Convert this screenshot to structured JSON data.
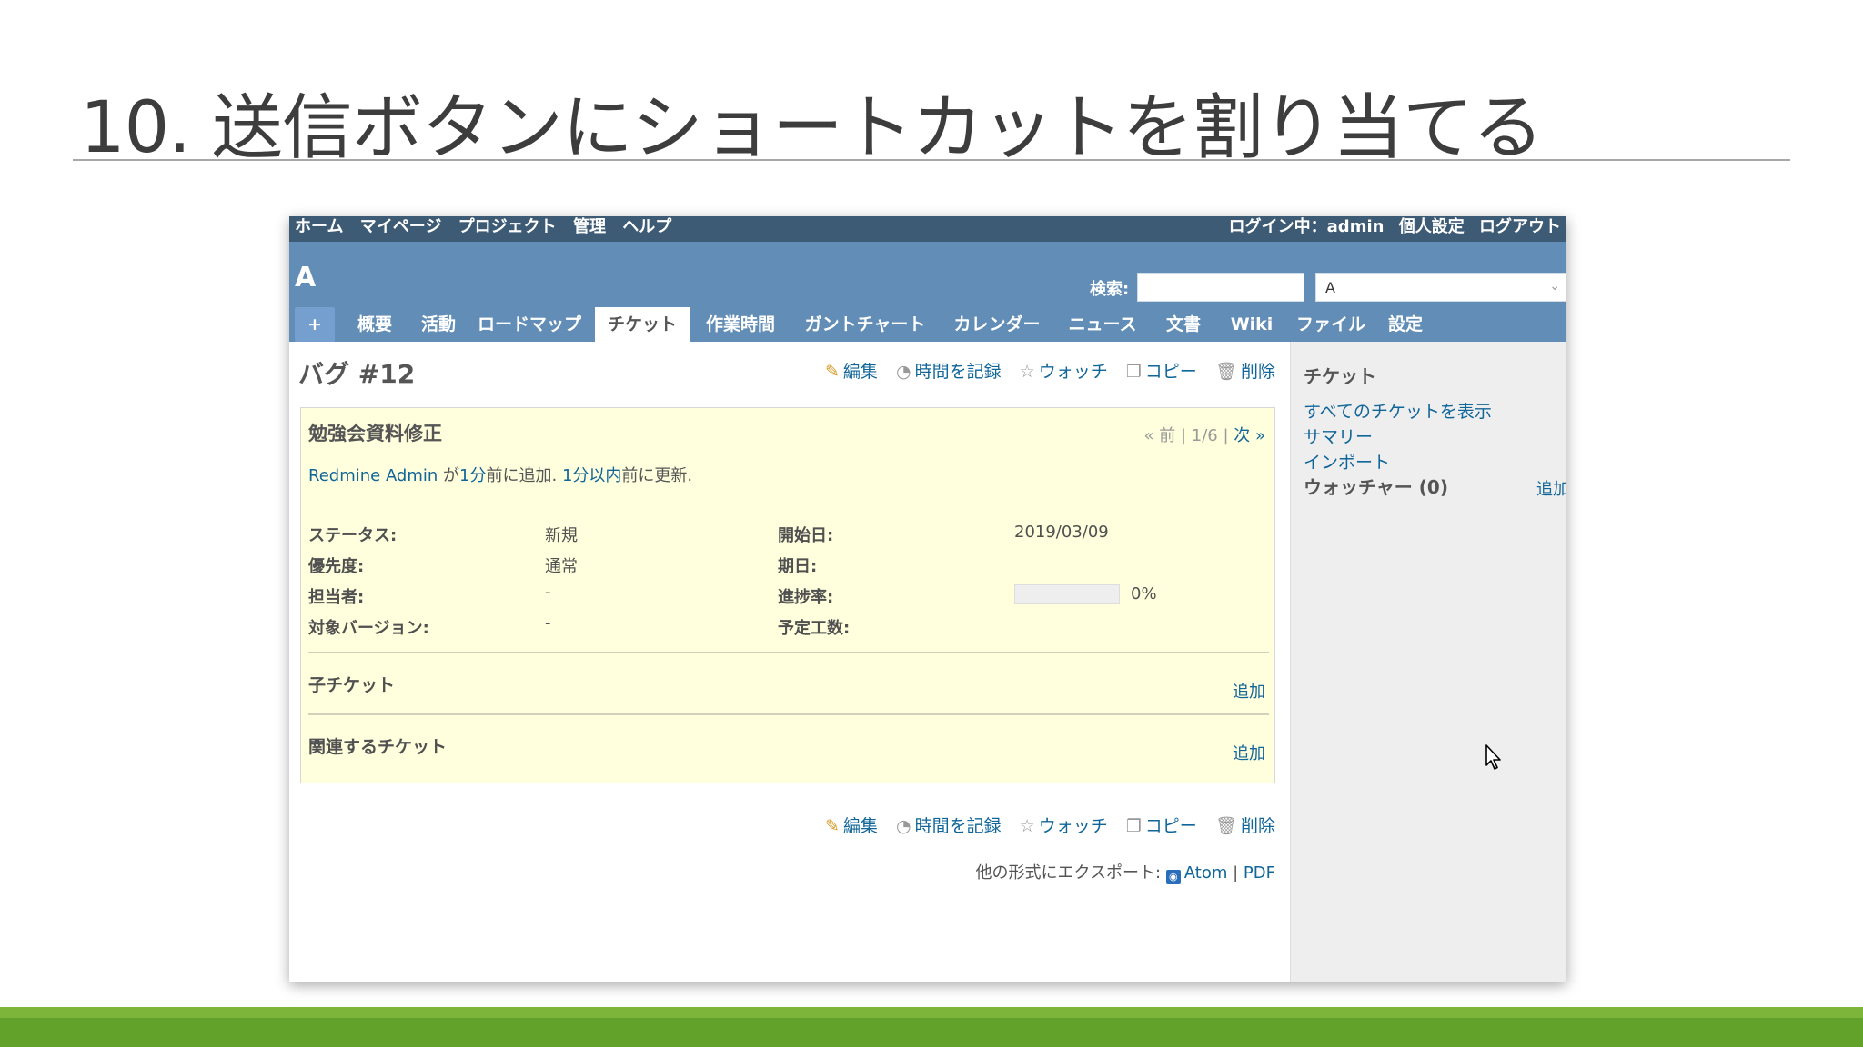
{
  "slide": {
    "title": "10. 送信ボタンにショートカットを割り当てる"
  },
  "top_menu": {
    "items": [
      "ホーム",
      "マイページ",
      "プロジェクト",
      "管理",
      "ヘルプ"
    ],
    "logged_in_label": "ログイン中：",
    "user": "admin",
    "my_account": "個人設定",
    "logout": "ログアウト"
  },
  "header": {
    "project_title": "A",
    "search_label": "検索:",
    "search_value": "",
    "project_jump_value": "A"
  },
  "tabs": {
    "plus": "+",
    "overview": "概要",
    "activity": "活動",
    "roadmap": "ロードマップ",
    "issues": "チケット",
    "time": "作業時間",
    "gantt": "ガントチャート",
    "calendar": "カレンダー",
    "news": "ニュース",
    "documents": "文書",
    "wiki": "Wiki",
    "files": "ファイル",
    "settings": "設定"
  },
  "issue": {
    "heading": "バグ #12",
    "actions": {
      "edit": "編集",
      "log_time": "時間を記録",
      "watch": "ウォッチ",
      "copy": "コピー",
      "delete": "削除"
    },
    "subject": "勉強会資料修正",
    "prev": "« 前",
    "position": "1/6",
    "next": "次 »",
    "author": "Redmine Admin",
    "author_suffix": " が",
    "added_time": "1分",
    "added_suffix": "前に追加. ",
    "updated_time": "1分以内",
    "updated_suffix": "前に更新.",
    "attributes": {
      "status_label": "ステータス:",
      "status_value": "新規",
      "priority_label": "優先度:",
      "priority_value": "通常",
      "assignee_label": "担当者:",
      "assignee_value": "-",
      "version_label": "対象バージョン:",
      "version_value": "-",
      "start_label": "開始日:",
      "start_value": "2019/03/09",
      "due_label": "期日:",
      "due_value": "",
      "progress_label": "進捗率:",
      "progress_value": "0%",
      "progress_fraction": 0,
      "estimate_label": "予定工数:",
      "estimate_value": ""
    },
    "subtasks_title": "子チケット",
    "relations_title": "関連するチケット",
    "add_label": "追加"
  },
  "export": {
    "label": "他の形式にエクスポート:",
    "atom": "Atom",
    "separator": "|",
    "pdf": "PDF"
  },
  "sidebar": {
    "title": "チケット",
    "links": [
      "すべてのチケットを表示",
      "サマリー",
      "インポート"
    ],
    "watchers_title": "ウォッチャー (0)",
    "watchers_add": "追加"
  },
  "colors": {
    "top_menu": "#3e5b76",
    "header": "#628db6",
    "issue_bg": "#ffffdd",
    "link": "#116699",
    "footer_green": "#62a12a"
  }
}
